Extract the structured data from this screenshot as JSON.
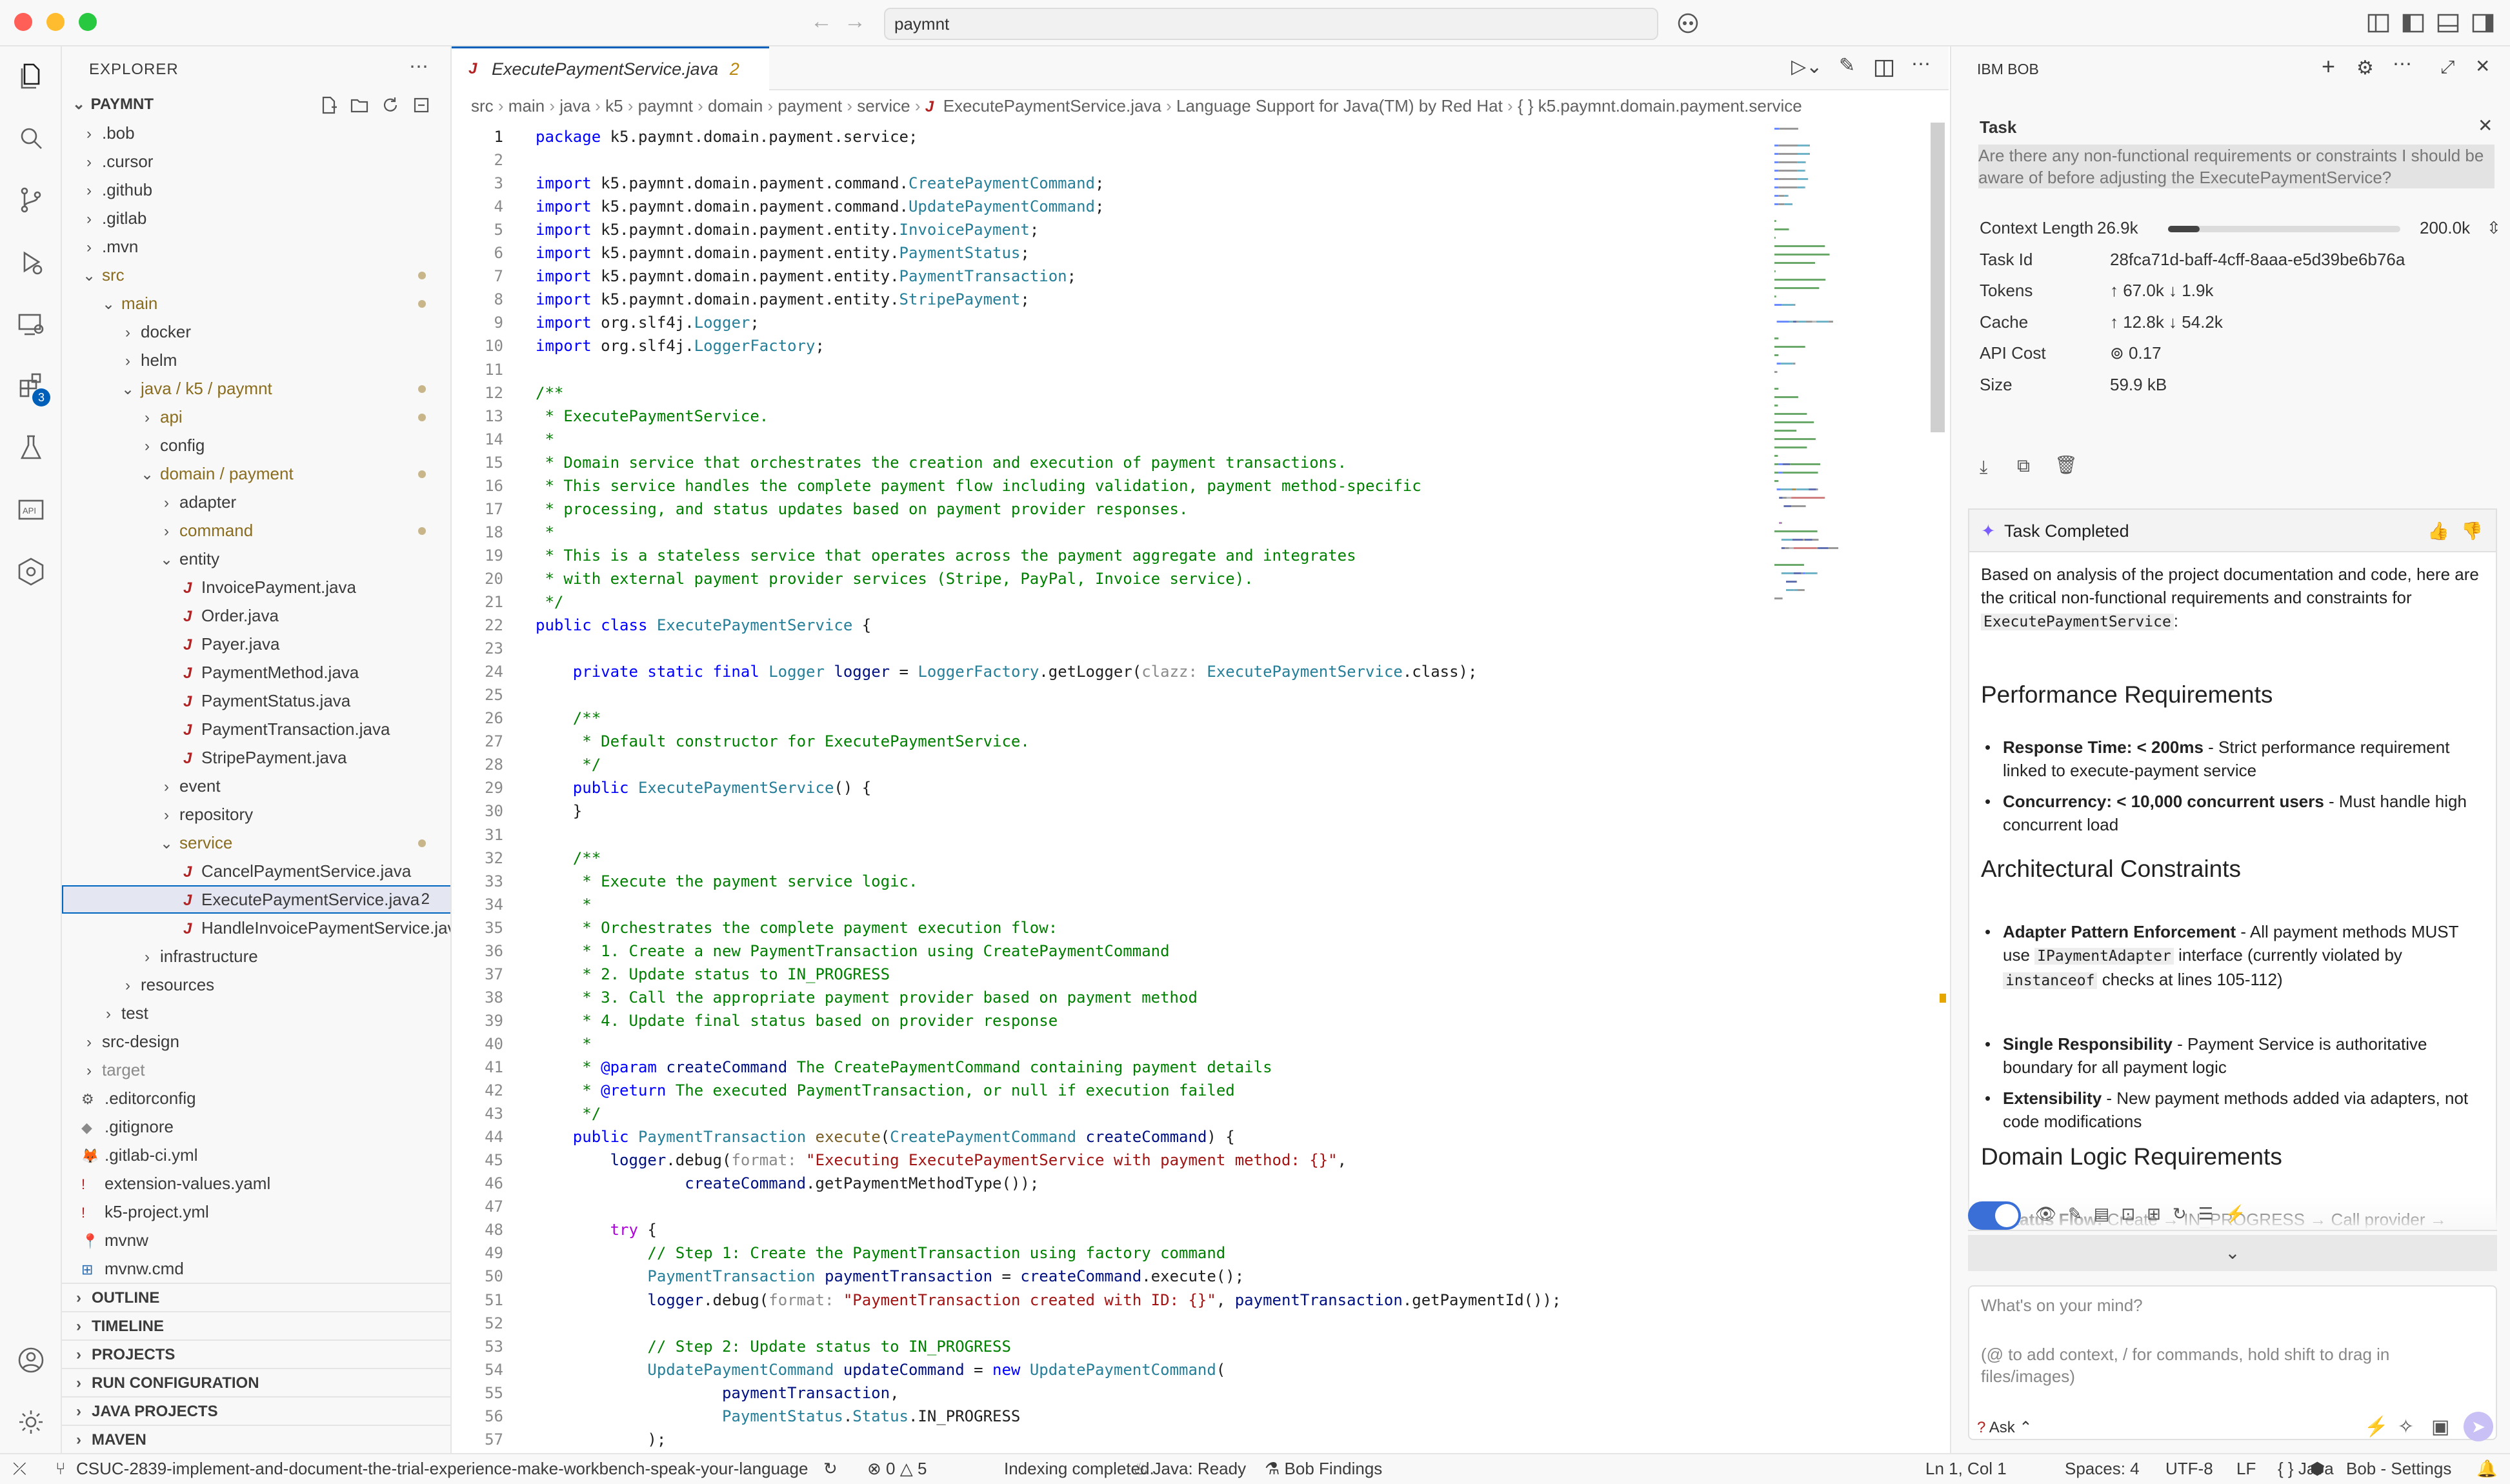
{
  "window": {
    "search": "paymnt"
  },
  "activity": {
    "ext_badge": "3"
  },
  "explorer": {
    "header": "EXPLORER",
    "root": "PAYMNT",
    "tree": [
      {
        "label": ".bob",
        "indent": 0,
        "kind": "folder",
        "open": false
      },
      {
        "label": ".cursor",
        "indent": 0,
        "kind": "folder",
        "open": false
      },
      {
        "label": ".github",
        "indent": 0,
        "kind": "folder",
        "open": false
      },
      {
        "label": ".gitlab",
        "indent": 0,
        "kind": "folder",
        "open": false
      },
      {
        "label": ".mvn",
        "indent": 0,
        "kind": "folder",
        "open": false
      },
      {
        "label": "src",
        "indent": 0,
        "kind": "folder",
        "open": true,
        "color": "#8a6d1e",
        "dot": true
      },
      {
        "label": "main",
        "indent": 1,
        "kind": "folder",
        "open": true,
        "color": "#8a6d1e",
        "dot": true
      },
      {
        "label": "docker",
        "indent": 2,
        "kind": "folder",
        "open": false
      },
      {
        "label": "helm",
        "indent": 2,
        "kind": "folder",
        "open": false
      },
      {
        "label": "java / k5 / paymnt",
        "indent": 2,
        "kind": "folder",
        "open": true,
        "color": "#8a6d1e",
        "dot": true
      },
      {
        "label": "api",
        "indent": 3,
        "kind": "folder",
        "open": false,
        "color": "#8a6d1e",
        "dot": true
      },
      {
        "label": "config",
        "indent": 3,
        "kind": "folder",
        "open": false
      },
      {
        "label": "domain / payment",
        "indent": 3,
        "kind": "folder",
        "open": true,
        "color": "#8a6d1e",
        "dot": true
      },
      {
        "label": "adapter",
        "indent": 4,
        "kind": "folder",
        "open": false
      },
      {
        "label": "command",
        "indent": 4,
        "kind": "folder",
        "open": false,
        "color": "#8a6d1e",
        "dot": true
      },
      {
        "label": "entity",
        "indent": 4,
        "kind": "folder",
        "open": true
      },
      {
        "label": "InvoicePayment.java",
        "indent": 5,
        "kind": "java"
      },
      {
        "label": "Order.java",
        "indent": 5,
        "kind": "java"
      },
      {
        "label": "Payer.java",
        "indent": 5,
        "kind": "java"
      },
      {
        "label": "PaymentMethod.java",
        "indent": 5,
        "kind": "java"
      },
      {
        "label": "PaymentStatus.java",
        "indent": 5,
        "kind": "java"
      },
      {
        "label": "PaymentTransaction.java",
        "indent": 5,
        "kind": "java"
      },
      {
        "label": "StripePayment.java",
        "indent": 5,
        "kind": "java"
      },
      {
        "label": "event",
        "indent": 4,
        "kind": "folder",
        "open": false
      },
      {
        "label": "repository",
        "indent": 4,
        "kind": "folder",
        "open": false
      },
      {
        "label": "service",
        "indent": 4,
        "kind": "folder",
        "open": true,
        "color": "#8a6d1e",
        "dot": true
      },
      {
        "label": "CancelPaymentService.java",
        "indent": 5,
        "kind": "java"
      },
      {
        "label": "ExecutePaymentService.java",
        "indent": 5,
        "kind": "java",
        "selected": true,
        "badge": "2"
      },
      {
        "label": "HandleInvoicePaymentService.java",
        "indent": 5,
        "kind": "java"
      },
      {
        "label": "infrastructure",
        "indent": 3,
        "kind": "folder",
        "open": false
      },
      {
        "label": "resources",
        "indent": 2,
        "kind": "folder",
        "open": false
      },
      {
        "label": "test",
        "indent": 1,
        "kind": "folder",
        "open": false
      },
      {
        "label": "src-design",
        "indent": 0,
        "kind": "folder",
        "open": false
      },
      {
        "label": "target",
        "indent": 0,
        "kind": "folder",
        "open": false,
        "color": "#8a8a8a"
      },
      {
        "label": ".editorconfig",
        "indent": 0,
        "kind": "gear"
      },
      {
        "label": ".gitignore",
        "indent": 0,
        "kind": "diamond"
      },
      {
        "label": ".gitlab-ci.yml",
        "indent": 0,
        "kind": "fox"
      },
      {
        "label": "extension-values.yaml",
        "indent": 0,
        "kind": "bang"
      },
      {
        "label": "k5-project.yml",
        "indent": 0,
        "kind": "bang"
      },
      {
        "label": "mvnw",
        "indent": 0,
        "kind": "pin"
      },
      {
        "label": "mvnw.cmd",
        "indent": 0,
        "kind": "win"
      }
    ],
    "sections": [
      "OUTLINE",
      "TIMELINE",
      "PROJECTS",
      "RUN CONFIGURATION",
      "JAVA PROJECTS",
      "MAVEN"
    ]
  },
  "editor": {
    "tab": {
      "title": "ExecutePaymentService.java",
      "badge": "2"
    },
    "breadcrumbs": [
      "src",
      "main",
      "java",
      "k5",
      "paymnt",
      "domain",
      "payment",
      "service",
      "ExecutePaymentService.java",
      "Language Support for Java(TM) by Red Hat",
      "{ } k5.paymnt.domain.payment.service"
    ],
    "lines": [
      [
        [
          "kw",
          "package "
        ],
        [
          "",
          "k5.paymnt.domain.payment.service;"
        ]
      ],
      [],
      [
        [
          "kw",
          "import "
        ],
        [
          "",
          "k5.paymnt.domain.payment.command."
        ],
        [
          "ty",
          "CreatePaymentCommand"
        ],
        [
          "",
          ";"
        ]
      ],
      [
        [
          "kw",
          "import "
        ],
        [
          "",
          "k5.paymnt.domain.payment.command."
        ],
        [
          "ty",
          "UpdatePaymentCommand"
        ],
        [
          "",
          ";"
        ]
      ],
      [
        [
          "kw",
          "import "
        ],
        [
          "",
          "k5.paymnt.domain.payment.entity."
        ],
        [
          "ty",
          "InvoicePayment"
        ],
        [
          "",
          ";"
        ]
      ],
      [
        [
          "kw",
          "import "
        ],
        [
          "",
          "k5.paymnt.domain.payment.entity."
        ],
        [
          "ty",
          "PaymentStatus"
        ],
        [
          "",
          ";"
        ]
      ],
      [
        [
          "kw",
          "import "
        ],
        [
          "",
          "k5.paymnt.domain.payment.entity."
        ],
        [
          "ty",
          "PaymentTransaction"
        ],
        [
          "",
          ";"
        ]
      ],
      [
        [
          "kw",
          "import "
        ],
        [
          "",
          "k5.paymnt.domain.payment.entity."
        ],
        [
          "ty",
          "StripePayment"
        ],
        [
          "",
          ";"
        ]
      ],
      [
        [
          "kw",
          "import "
        ],
        [
          "",
          "org.slf4j."
        ],
        [
          "ty",
          "Logger"
        ],
        [
          "",
          ";"
        ]
      ],
      [
        [
          "kw",
          "import "
        ],
        [
          "",
          "org.slf4j."
        ],
        [
          "ty",
          "LoggerFactory"
        ],
        [
          "",
          ";"
        ]
      ],
      [],
      [
        [
          "cm",
          "/**"
        ]
      ],
      [
        [
          "cm",
          " * ExecutePaymentService."
        ]
      ],
      [
        [
          "cm",
          " *"
        ]
      ],
      [
        [
          "cm",
          " * Domain service that orchestrates the creation and execution of payment transactions."
        ]
      ],
      [
        [
          "cm",
          " * This service handles the complete payment flow including validation, payment method-specific"
        ]
      ],
      [
        [
          "cm",
          " * processing, and status updates based on payment provider responses."
        ]
      ],
      [
        [
          "cm",
          " *"
        ]
      ],
      [
        [
          "cm",
          " * This is a stateless service that operates across the payment aggregate and integrates"
        ]
      ],
      [
        [
          "cm",
          " * with external payment provider services (Stripe, PayPal, Invoice service)."
        ]
      ],
      [
        [
          "cm",
          " */"
        ]
      ],
      [
        [
          "kw",
          "public class "
        ],
        [
          "ty",
          "ExecutePaymentService"
        ],
        [
          "",
          " {"
        ]
      ],
      [],
      [
        [
          "",
          "    "
        ],
        [
          "kw",
          "private static final "
        ],
        [
          "ty",
          "Logger "
        ],
        [
          "vr",
          "logger"
        ],
        [
          "",
          " = "
        ],
        [
          "ty",
          "LoggerFactory"
        ],
        [
          "",
          ".getLogger("
        ],
        [
          "hint",
          "clazz: "
        ],
        [
          "ty",
          "ExecutePaymentService"
        ],
        [
          "",
          ".class);"
        ]
      ],
      [],
      [
        [
          "cm",
          "    /**"
        ]
      ],
      [
        [
          "cm",
          "     * Default constructor for ExecutePaymentService."
        ]
      ],
      [
        [
          "cm",
          "     */"
        ]
      ],
      [
        [
          "",
          "    "
        ],
        [
          "kw",
          "public "
        ],
        [
          "ty",
          "ExecutePaymentService"
        ],
        [
          "",
          "() {"
        ]
      ],
      [
        [
          "",
          "    }"
        ]
      ],
      [],
      [
        [
          "cm",
          "    /**"
        ]
      ],
      [
        [
          "cm",
          "     * Execute the payment service logic."
        ]
      ],
      [
        [
          "cm",
          "     *"
        ]
      ],
      [
        [
          "cm",
          "     * Orchestrates the complete payment execution flow:"
        ]
      ],
      [
        [
          "cm",
          "     * 1. Create a new PaymentTransaction using CreatePaymentCommand"
        ]
      ],
      [
        [
          "cm",
          "     * 2. Update status to IN_PROGRESS"
        ]
      ],
      [
        [
          "cm",
          "     * 3. Call the appropriate payment provider based on payment method"
        ]
      ],
      [
        [
          "cm",
          "     * 4. Update final status based on provider response"
        ]
      ],
      [
        [
          "cm",
          "     *"
        ]
      ],
      [
        [
          "cm",
          "     * "
        ],
        [
          "kw",
          "@param "
        ],
        [
          "vr",
          "createCommand"
        ],
        [
          "cm",
          " The CreatePaymentCommand containing payment details"
        ]
      ],
      [
        [
          "cm",
          "     * "
        ],
        [
          "kw",
          "@return"
        ],
        [
          "cm",
          " The executed PaymentTransaction, or null if execution failed"
        ]
      ],
      [
        [
          "cm",
          "     */"
        ]
      ],
      [
        [
          "",
          "    "
        ],
        [
          "kw",
          "public "
        ],
        [
          "ty",
          "PaymentTransaction "
        ],
        [
          "fn",
          "execute"
        ],
        [
          "",
          "("
        ],
        [
          "ty",
          "CreatePaymentCommand "
        ],
        [
          "vr",
          "createCommand"
        ],
        [
          "",
          ") {"
        ]
      ],
      [
        [
          "",
          "        "
        ],
        [
          "vr",
          "logger"
        ],
        [
          "",
          ".debug("
        ],
        [
          "hint",
          "format: "
        ],
        [
          "str",
          "\"Executing ExecutePaymentService with payment method: {}\""
        ],
        [
          "",
          ","
        ]
      ],
      [
        [
          "",
          "                "
        ],
        [
          "vr",
          "createCommand"
        ],
        [
          "",
          ".getPaymentMethodType());"
        ]
      ],
      [],
      [
        [
          "",
          "        "
        ],
        [
          "ctl",
          "try"
        ],
        [
          "",
          " {"
        ]
      ],
      [
        [
          "cm",
          "            // Step 1: Create the PaymentTransaction using factory command"
        ]
      ],
      [
        [
          "",
          "            "
        ],
        [
          "ty",
          "PaymentTransaction "
        ],
        [
          "vr",
          "paymentTransaction"
        ],
        [
          "",
          " = "
        ],
        [
          "vr",
          "createCommand"
        ],
        [
          "",
          ".execute();"
        ]
      ],
      [
        [
          "",
          "            "
        ],
        [
          "vr",
          "logger"
        ],
        [
          "",
          ".debug("
        ],
        [
          "hint",
          "format: "
        ],
        [
          "str",
          "\"PaymentTransaction created with ID: {}\""
        ],
        [
          "",
          ", "
        ],
        [
          "vr",
          "paymentTransaction"
        ],
        [
          "",
          ".getPaymentId());"
        ]
      ],
      [],
      [
        [
          "cm",
          "            // Step 2: Update status to IN_PROGRESS"
        ]
      ],
      [
        [
          "",
          "            "
        ],
        [
          "ty",
          "UpdatePaymentCommand "
        ],
        [
          "vr",
          "updateCommand"
        ],
        [
          "",
          " = "
        ],
        [
          "kw",
          "new "
        ],
        [
          "ty",
          "UpdatePaymentCommand"
        ],
        [
          "",
          "("
        ]
      ],
      [
        [
          "",
          "                    "
        ],
        [
          "vr",
          "paymentTransaction"
        ],
        [
          "",
          ","
        ]
      ],
      [
        [
          "",
          "                    "
        ],
        [
          "ty",
          "PaymentStatus"
        ],
        [
          "",
          "."
        ],
        [
          "ty",
          "Status"
        ],
        [
          "",
          ".IN_PROGRESS"
        ]
      ],
      [
        [
          "",
          "            );"
        ]
      ]
    ]
  },
  "bob": {
    "header": "IBM BOB",
    "task_title": "Task",
    "task_question": "Are there any non-functional requirements or constraints I should be aware of before adjusting the ExecutePaymentService?",
    "metrics": [
      {
        "label": "Context Length",
        "value": "26.9k",
        "max": "200.0k",
        "fill": 0.135
      },
      {
        "label": "Task Id",
        "value": "28fca71d-baff-4cff-8aaa-e5d39be6b76a"
      },
      {
        "label": "Tokens",
        "value": "↑ 67.0k ↓ 1.9k"
      },
      {
        "label": "Cache",
        "value": "↑ 12.8k ↓ 54.2k"
      },
      {
        "label": "API Cost",
        "value": "0.17"
      },
      {
        "label": "Size",
        "value": "59.9 kB"
      }
    ],
    "completed_title": "Task Completed",
    "intro_a": "Based on analysis of the project documentation and code, here are the critical non-functional requirements and constraints for",
    "intro_code": "ExecutePaymentService",
    "intro_b": ":",
    "sections": [
      {
        "title": "Performance Requirements",
        "items": [
          {
            "bold": "Response Time: < 200ms",
            "text": " - Strict performance requirement linked to execute-payment service"
          },
          {
            "bold": "Concurrency: < 10,000 concurrent users",
            "text": " - Must handle high concurrent load"
          }
        ]
      },
      {
        "title": "Architectural Constraints",
        "items": [
          {
            "bold": "Adapter Pattern Enforcement",
            "text": " - All payment methods MUST use ",
            "code": "IPaymentAdapter",
            "text2": " interface (currently violated by ",
            "code2": "instanceof",
            "text3": " checks at lines 105-112)"
          },
          {
            "bold": "Single Responsibility",
            "text": " - Payment Service is authoritative boundary for all payment logic"
          },
          {
            "bold": "Extensibility",
            "text": " - New payment methods added via adapters, not code modifications"
          }
        ]
      },
      {
        "title": "Domain Logic Requirements",
        "items": [
          {
            "bold": "Status Flow:",
            "text": " Create → IN_PROGRESS → Call provider → COMPLETED/FAILED/IN_PROGRESS"
          }
        ]
      }
    ],
    "input_placeholder": "What's on your mind?",
    "input_hint": "(@ to add context, / for commands, hold shift to drag in files/images)",
    "mode": "Ask"
  },
  "status": {
    "branch": "CSUC-2839-implement-and-document-the-trial-experience-make-workbench-speak-your-language",
    "errors": "0",
    "warnings": "5",
    "indexing": "Indexing completed.",
    "java": "Java: Ready",
    "bob_findings": "Bob Findings",
    "cursor": "Ln 1, Col 1",
    "spaces": "Spaces: 4",
    "encoding": "UTF-8",
    "eol": "LF",
    "lang": "Java",
    "bob_settings": "Bob - Settings"
  }
}
